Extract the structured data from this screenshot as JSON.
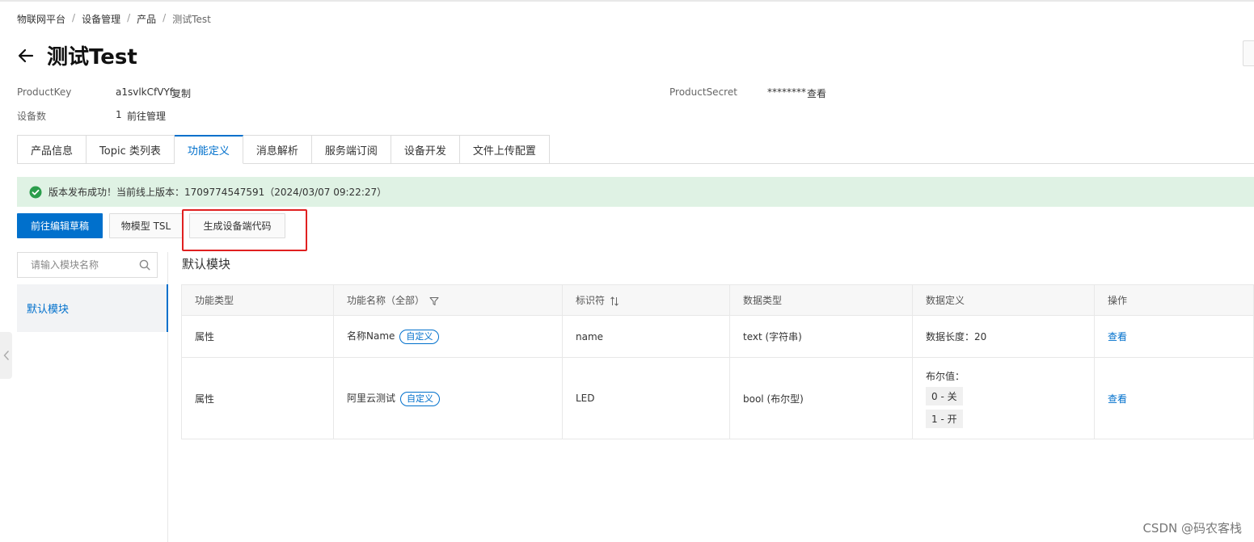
{
  "breadcrumb": [
    "物联网平台",
    "设备管理",
    "产品",
    "测试Test"
  ],
  "page_title": "测试Test",
  "meta": {
    "product_key_label": "ProductKey",
    "product_key_value": "a1svlkCfVYf",
    "copy_link": "复制",
    "product_secret_label": "ProductSecret",
    "product_secret_value": "********",
    "view_link": "查看",
    "device_count_label": "设备数",
    "device_count_value": "1",
    "manage_link": "前往管理"
  },
  "tabs": [
    "产品信息",
    "Topic 类列表",
    "功能定义",
    "消息解析",
    "服务端订阅",
    "设备开发",
    "文件上传配置"
  ],
  "active_tab": "功能定义",
  "alert": "版本发布成功！当前线上版本：1709774547591（2024/03/07 09:22:27）",
  "buttons": {
    "edit_draft": "前往编辑草稿",
    "tsl": "物模型 TSL",
    "gen_code": "生成设备端代码"
  },
  "search": {
    "placeholder": "请输入模块名称"
  },
  "module_item": "默认模块",
  "section_title": "默认模块",
  "table": {
    "headers": [
      "功能类型",
      "功能名称（全部）",
      "标识符",
      "数据类型",
      "数据定义",
      "操作"
    ],
    "rows": [
      {
        "type": "属性",
        "name": "名称Name",
        "tag": "自定义",
        "identifier": "name",
        "data_type": "text (字符串)",
        "definition": "数据长度：20",
        "action": "查看"
      },
      {
        "type": "属性",
        "name": "阿里云测试",
        "tag": "自定义",
        "identifier": "LED",
        "data_type": "bool (布尔型)",
        "definition_label": "布尔值：",
        "enum": [
          "0 - 关",
          "1 - 开"
        ],
        "action": "查看"
      }
    ]
  },
  "watermark": "CSDN @码农客栈",
  "colors": {
    "primary": "#0070cc",
    "success_bg": "#dff2e4",
    "success_icon": "#2a9d4b",
    "highlight": "#e02020"
  }
}
